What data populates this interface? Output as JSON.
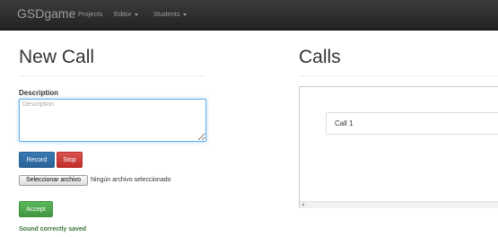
{
  "navbar": {
    "brand": "GSDgame",
    "items": [
      {
        "label": "Projects"
      },
      {
        "label": "Editor"
      },
      {
        "label": "Students"
      }
    ]
  },
  "new_call": {
    "title": "New Call",
    "description_label": "Description",
    "description_placeholder": "Description",
    "description_value": "",
    "record_label": "Record",
    "stop_label": "Stop",
    "file_button_label": "Seleccionar archivo",
    "file_status": "Ningún archivo seleccionado",
    "accept_label": "Accept",
    "status_message": "Sound correctly saved"
  },
  "calls": {
    "title": "Calls",
    "items": [
      {
        "label": "Call 1"
      }
    ]
  },
  "colors": {
    "navbar_bg": "#222222",
    "primary": "#337ab7",
    "danger": "#d9534f",
    "success": "#5cb85c",
    "success_text": "#3c763d"
  }
}
